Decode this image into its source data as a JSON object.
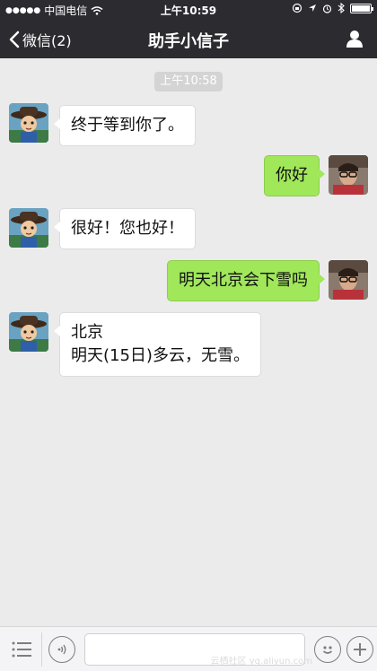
{
  "status_bar": {
    "signal": "●●●●●",
    "carrier": "中国电信",
    "time": "上午10:59"
  },
  "nav": {
    "back_label": "微信(2)",
    "title": "助手小信子"
  },
  "chat": {
    "timestamp": "上午10:58",
    "messages": [
      {
        "from": "bot",
        "lines": [
          "终于等到你了。"
        ]
      },
      {
        "from": "me",
        "lines": [
          "你好"
        ]
      },
      {
        "from": "bot",
        "lines": [
          "很好！您也好！"
        ]
      },
      {
        "from": "me",
        "lines": [
          "明天北京会下雪吗"
        ]
      },
      {
        "from": "bot",
        "lines": [
          "北京",
          "明天(15日)多云，无雪。"
        ]
      }
    ]
  },
  "input_bar": {
    "text_value": ""
  },
  "watermark": "云栖社区 yq.aliyun.com",
  "colors": {
    "header_bg": "#2b2b30",
    "chat_bg": "#ebebeb",
    "outgoing_bubble": "#a0e75a",
    "incoming_bubble": "#ffffff"
  },
  "icons": {
    "back": "chevron-left-icon",
    "profile": "person-icon",
    "menu": "list-menu-icon",
    "voice": "voice-icon",
    "emoji": "emoji-icon",
    "add": "plus-icon"
  }
}
